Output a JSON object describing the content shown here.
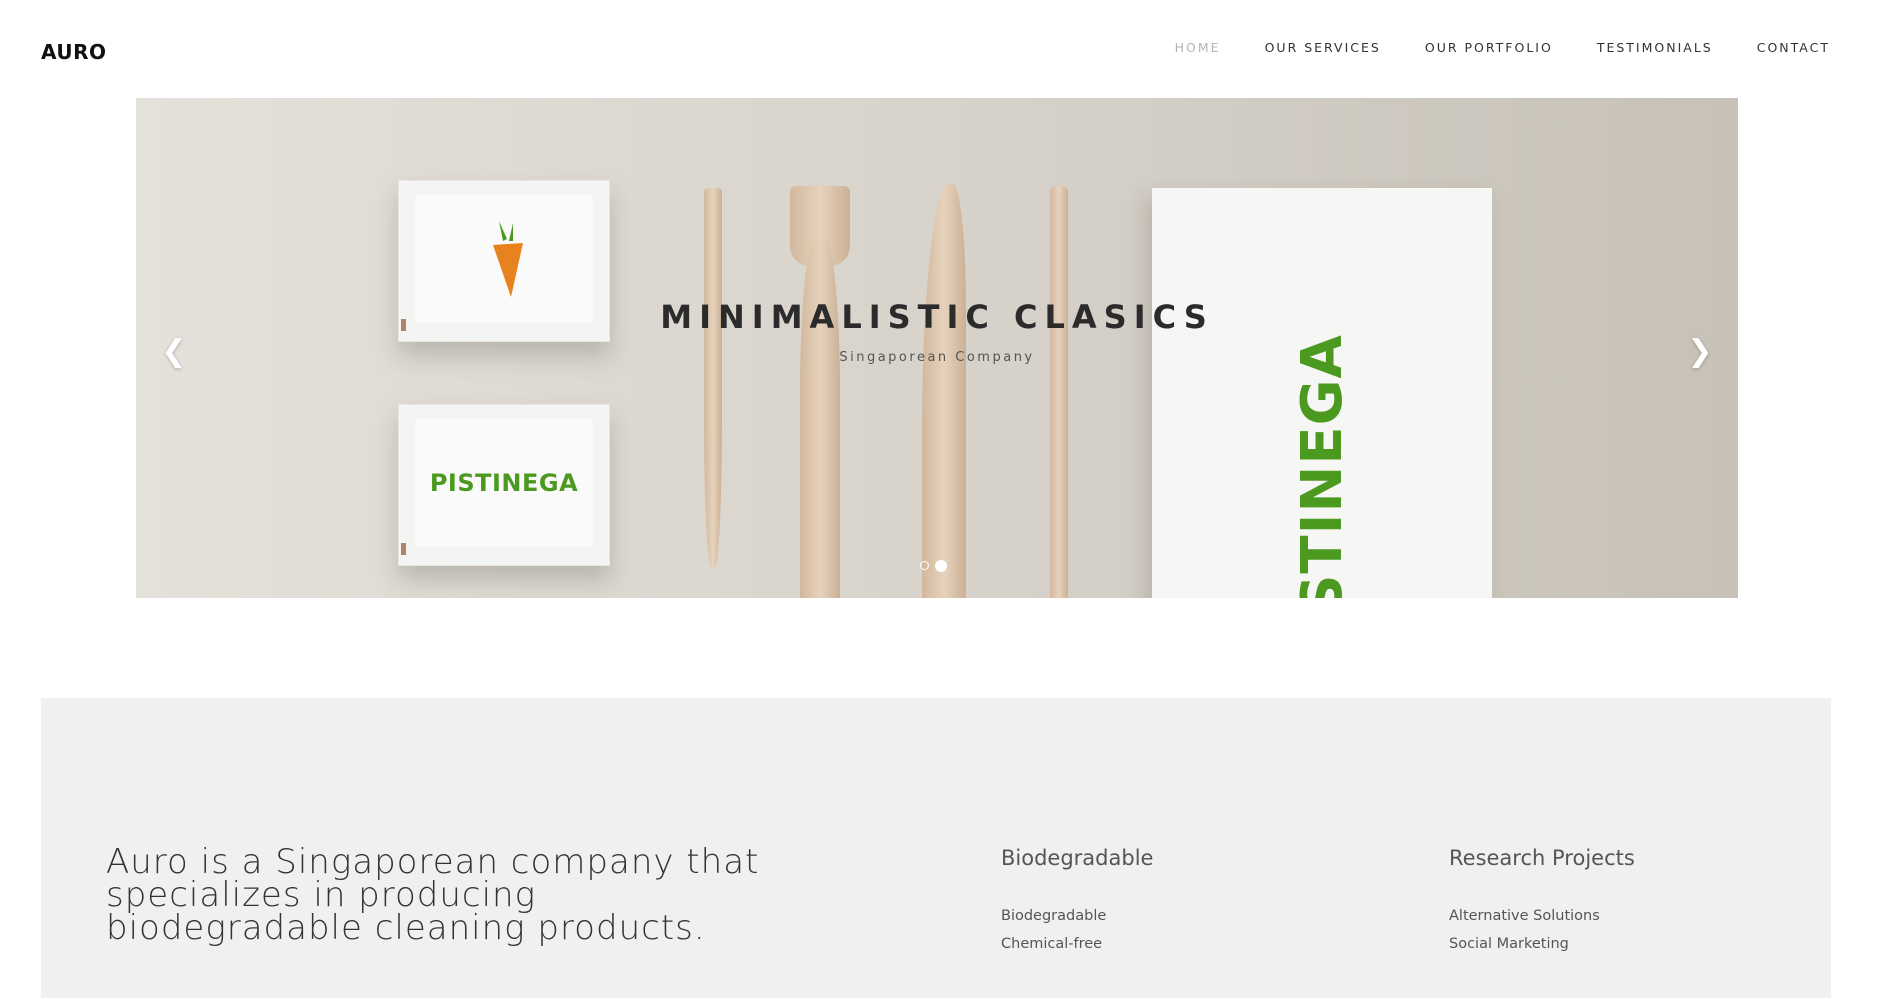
{
  "brand": "AURO",
  "nav": {
    "items": [
      {
        "label": "HOME",
        "active": true
      },
      {
        "label": "OUR SERVICES",
        "active": false
      },
      {
        "label": "OUR PORTFOLIO",
        "active": false
      },
      {
        "label": "TESTIMONIALS",
        "active": false
      },
      {
        "label": "CONTACT",
        "active": false
      }
    ]
  },
  "hero": {
    "title": "MINIMALISTIC CLASICS",
    "subtitle": "Singaporean Company",
    "product_logo": "PISTINEGA",
    "napkin_logo": "STINEGA",
    "slide_count": 2,
    "active_slide": 2
  },
  "about": {
    "text": "Auro is a Singaporean company that specializes in producing biodegradable cleaning products."
  },
  "columns": [
    {
      "heading": "Biodegradable",
      "links": [
        "Biodegradable",
        "Chemical-free"
      ]
    },
    {
      "heading": "Research Projects",
      "links": [
        "Alternative Solutions",
        "Social Marketing"
      ]
    }
  ],
  "colors": {
    "accent_green": "#4b9a1f",
    "carrot_orange": "#e8821e",
    "panel_bg": "#f0f0f0"
  },
  "icons": {
    "prev": "chevron-left-icon",
    "next": "chevron-right-icon"
  }
}
